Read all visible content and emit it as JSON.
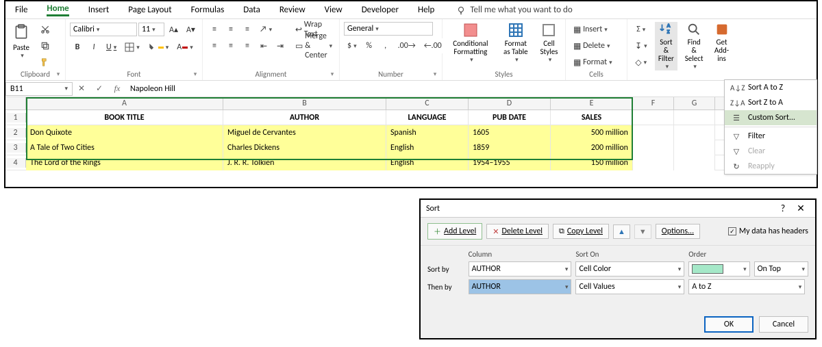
{
  "tabs": {
    "list": [
      "File",
      "Home",
      "Insert",
      "Page Layout",
      "Formulas",
      "Data",
      "Review",
      "View",
      "Developer",
      "Help"
    ],
    "active": "Home",
    "tell_me": "Tell me what you want to do"
  },
  "font": {
    "name": "Calibri",
    "size": "11"
  },
  "number_format": "General",
  "group_labels": {
    "clipboard": "Clipboard",
    "font": "Font",
    "alignment": "Alignment",
    "number": "Number",
    "styles": "Styles",
    "cells": "Cells",
    "editing": ""
  },
  "ribbon": {
    "paste": "Paste",
    "wrap_text": "Wrap Text",
    "merge_center": "Merge & Center",
    "cond_fmt": "Conditional Formatting",
    "fmt_table": "Format as Table",
    "cell_styles": "Cell Styles",
    "cells": {
      "insert": "Insert",
      "delete": "Delete",
      "format": "Format"
    },
    "sort_filter": "Sort & Filter",
    "find_select": "Find & Select",
    "addins": "Get Add-ins"
  },
  "name_box": "B11",
  "fx_value": "Napoleon Hill",
  "columns": [
    "A",
    "B",
    "C",
    "D",
    "E",
    "F",
    "G"
  ],
  "headers": [
    "BOOK TITLE",
    "AUTHOR",
    "LANGUAGE",
    "PUB DATE",
    "SALES"
  ],
  "rows": [
    {
      "n": "1"
    },
    {
      "n": "2",
      "cells": [
        "Don Quixote",
        "Miguel de Cervantes",
        "Spanish",
        "1605",
        "500 million"
      ]
    },
    {
      "n": "3",
      "cells": [
        "A Tale of Two Cities",
        "Charles Dickens",
        "English",
        "1859",
        "200 million"
      ]
    },
    {
      "n": "4",
      "cells": [
        "The Lord of the Rings",
        "J. R. R. Tolkien",
        "English",
        "1954–1955",
        "150 million"
      ]
    }
  ],
  "sf_menu": {
    "sort_az": "Sort A to Z",
    "sort_za": "Sort Z to A",
    "custom": "Custom Sort...",
    "filter": "Filter",
    "clear": "Clear",
    "reapply": "Reapply"
  },
  "sort_dialog": {
    "title": "Sort",
    "add": "Add Level",
    "delete": "Delete Level",
    "copy": "Copy Level",
    "options": "Options...",
    "headers_check": "My data has headers",
    "col_hdr": "Column",
    "son_hdr": "Sort On",
    "ord_hdr": "Order",
    "sortby_label": "Sort by",
    "thenby_label": "Then by",
    "level1": {
      "column": "AUTHOR",
      "sort_on": "Cell Color",
      "order_color": "#a5e8c8",
      "on_top": "On Top"
    },
    "level2": {
      "column": "AUTHOR",
      "sort_on": "Cell Values",
      "order": "A to Z"
    },
    "ok": "OK",
    "cancel": "Cancel"
  }
}
